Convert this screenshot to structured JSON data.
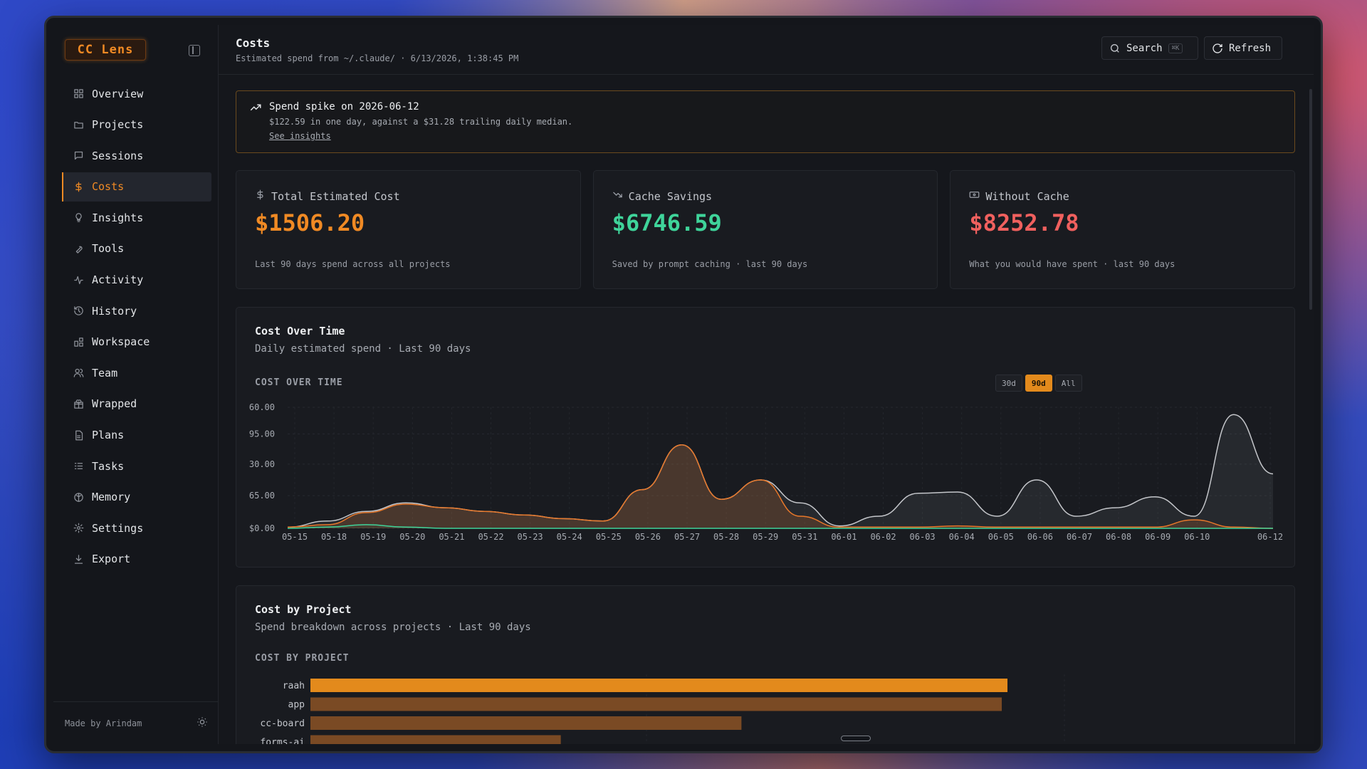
{
  "app": {
    "logo": "CC Lens",
    "footer": "Made by Arindam"
  },
  "sidebar": {
    "items": [
      {
        "label": "Overview",
        "icon": "overview-icon"
      },
      {
        "label": "Projects",
        "icon": "folder-icon"
      },
      {
        "label": "Sessions",
        "icon": "chat-icon"
      },
      {
        "label": "Costs",
        "icon": "dollar-icon",
        "active": true
      },
      {
        "label": "Insights",
        "icon": "lightbulb-icon"
      },
      {
        "label": "Tools",
        "icon": "wrench-icon"
      },
      {
        "label": "Activity",
        "icon": "activity-icon"
      },
      {
        "label": "History",
        "icon": "history-icon"
      },
      {
        "label": "Workspace",
        "icon": "workspace-icon"
      },
      {
        "label": "Team",
        "icon": "team-icon"
      },
      {
        "label": "Wrapped",
        "icon": "gift-icon"
      },
      {
        "label": "Plans",
        "icon": "file-icon"
      },
      {
        "label": "Tasks",
        "icon": "tasks-icon"
      },
      {
        "label": "Memory",
        "icon": "brain-icon"
      },
      {
        "label": "Settings",
        "icon": "gear-icon"
      },
      {
        "label": "Export",
        "icon": "download-icon"
      }
    ]
  },
  "header": {
    "title": "Costs",
    "subtitle": "Estimated spend from ~/.claude/ · 6/13/2026, 1:38:45 PM",
    "search_label": "Search",
    "search_kbd": "⌘K",
    "refresh_label": "Refresh"
  },
  "alert": {
    "title": "Spend spike on 2026-06-12",
    "text": "$122.59 in one day, against a $31.28 trailing daily median.",
    "link": "See insights"
  },
  "cards": [
    {
      "label": "Total Estimated Cost",
      "value": "$1506.20",
      "foot": "Last 90 days spend across all projects",
      "color": "#f08a24",
      "icon": "dollar-icon"
    },
    {
      "label": "Cache Savings",
      "value": "$6746.59",
      "foot": "Saved by prompt caching · last 90 days",
      "color": "#3fd49a",
      "icon": "trending-down-icon"
    },
    {
      "label": "Without Cache",
      "value": "$8252.78",
      "foot": "What you would have spent · last 90 days",
      "color": "#f0605e",
      "icon": "banknote-icon"
    }
  ],
  "cost_over_time": {
    "title": "Cost Over Time",
    "subtitle": "Daily estimated spend · Last 90 days",
    "caption": "COST OVER TIME",
    "ranges": [
      "30d",
      "90d",
      "All"
    ],
    "active_range": "90d"
  },
  "cost_by_project": {
    "title": "Cost by Project",
    "subtitle": "Spend breakdown across projects · Last 90 days",
    "caption": "COST BY PROJECT"
  },
  "chart_data": [
    {
      "type": "area",
      "title": "COST OVER TIME",
      "ylabels": [
        "60.00",
        "95.00",
        "30.00",
        "65.00",
        "$0.00"
      ],
      "x": [
        "05-15",
        "05-18",
        "05-19",
        "05-20",
        "05-21",
        "05-22",
        "05-23",
        "05-24",
        "05-25",
        "05-26",
        "05-27",
        "05-28",
        "05-29",
        "05-31",
        "06-01",
        "06-02",
        "06-03",
        "06-04",
        "06-05",
        "06-06",
        "06-07",
        "06-08",
        "06-09",
        "06-10",
        "06-12"
      ],
      "series": [
        {
          "color": "#c4c6ca",
          "values": [
            1,
            6,
            14,
            21,
            17,
            14,
            11,
            8,
            6,
            32,
            69,
            24,
            40,
            21,
            2,
            10,
            29,
            30,
            10,
            40,
            10,
            17,
            26,
            10,
            94,
            45
          ]
        },
        {
          "color": "#e8782a",
          "values": [
            1,
            3,
            13,
            20,
            17,
            14,
            11,
            8,
            6,
            32,
            69,
            24,
            40,
            10,
            1,
            1,
            1,
            2,
            1,
            1,
            1,
            1,
            1,
            7,
            1,
            0
          ]
        },
        {
          "color": "#3fd49a",
          "values": [
            0,
            1,
            3,
            1,
            0,
            0,
            0,
            0,
            0,
            0,
            0,
            0,
            0,
            0,
            0,
            0,
            0,
            0,
            0,
            0,
            0,
            0,
            0,
            0,
            0,
            0
          ]
        }
      ]
    },
    {
      "type": "bar",
      "title": "COST BY PROJECT",
      "categories": [
        "raah",
        "app",
        "cc-board",
        "forms-ai"
      ],
      "values": [
        490,
        486,
        303,
        176
      ],
      "colors": [
        "#e38a1c",
        "#7a4a24",
        "#7a4a24",
        "#7a4a24"
      ]
    }
  ]
}
